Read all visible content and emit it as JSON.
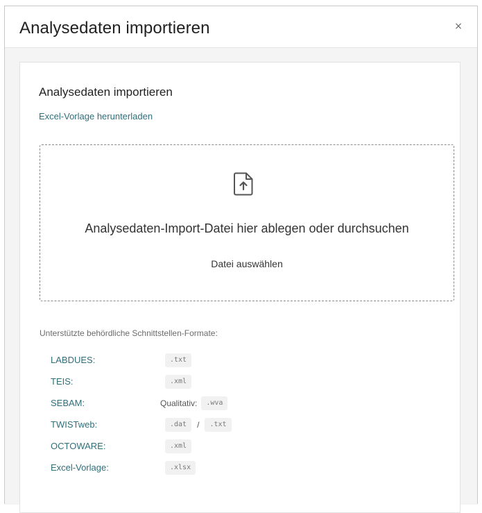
{
  "dialog": {
    "title": "Analysedaten importieren",
    "close_symbol": "×"
  },
  "card": {
    "title": "Analysedaten importieren",
    "template_link": "Excel-Vorlage herunterladen"
  },
  "dropzone": {
    "icon": "file-upload-icon",
    "text": "Analysedaten-Import-Datei hier ablegen oder durchsuchen",
    "choose_label": "Datei auswählen"
  },
  "formats": {
    "label": "Unterstützte behördliche Schnittstellen-Formate:",
    "rows": [
      {
        "name": "LABDUES:",
        "ext1": ".txt"
      },
      {
        "name": "TEIS:",
        "ext1": ".xml"
      },
      {
        "name": "SEBAM:",
        "prefix": "Qualitativ:",
        "ext1": ".wva"
      },
      {
        "name": "TWISTweb:",
        "ext1": ".dat",
        "separator": "/",
        "ext2": ".txt"
      },
      {
        "name": "OCTOWARE:",
        "ext1": ".xml"
      },
      {
        "name": "Excel-Vorlage:",
        "ext1": ".xlsx"
      }
    ]
  },
  "colors": {
    "accent": "#2f6f7a",
    "background": "#f4f4f4",
    "chip": "#f1f1f1"
  }
}
